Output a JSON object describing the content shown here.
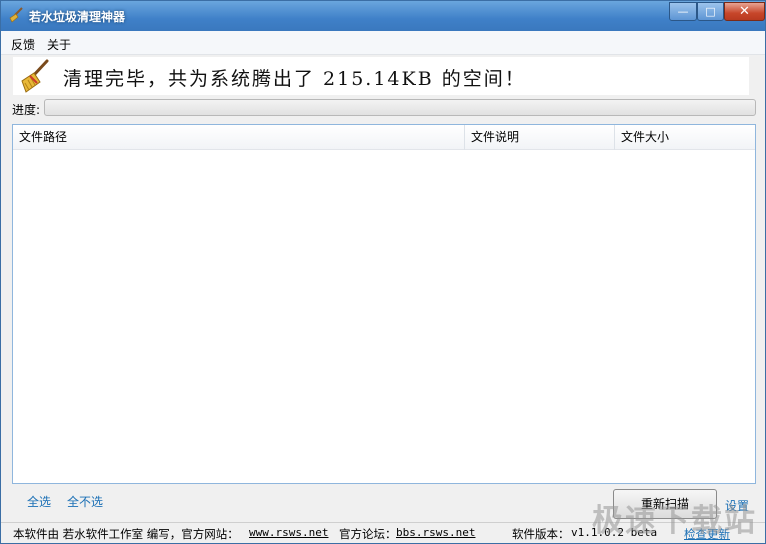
{
  "window": {
    "title": "若水垃圾清理神器"
  },
  "titlebar_controls": {
    "minimize": "—",
    "maximize": "□",
    "close": "✕"
  },
  "menu": {
    "items": [
      "反馈",
      "关于"
    ]
  },
  "banner": {
    "message": "清理完毕，共为系统腾出了 215.14KB 的空间！"
  },
  "progress": {
    "label": "进度:",
    "value_percent": 0
  },
  "list": {
    "columns": [
      "文件路径",
      "文件说明",
      "文件大小"
    ],
    "rows": []
  },
  "actions": {
    "select_all": "全选",
    "select_none": "全不选",
    "rescan": "重新扫描",
    "settings": "设置"
  },
  "status": {
    "credit": "本软件由 若水软件工作室 编写，官方网站：",
    "site_url": "www.rsws.net",
    "forum_label": "官方论坛：",
    "forum_url": "bbs.rsws.net",
    "version_label": "软件版本：",
    "version": "v1.1.0.2 beta",
    "update_link": "检查更新"
  },
  "watermark": "极速下载站",
  "colors": {
    "title_bar": "#3f80c8",
    "link": "#1a6fb5",
    "list_border": "#8fb6dd",
    "close_button": "#c7462a"
  }
}
